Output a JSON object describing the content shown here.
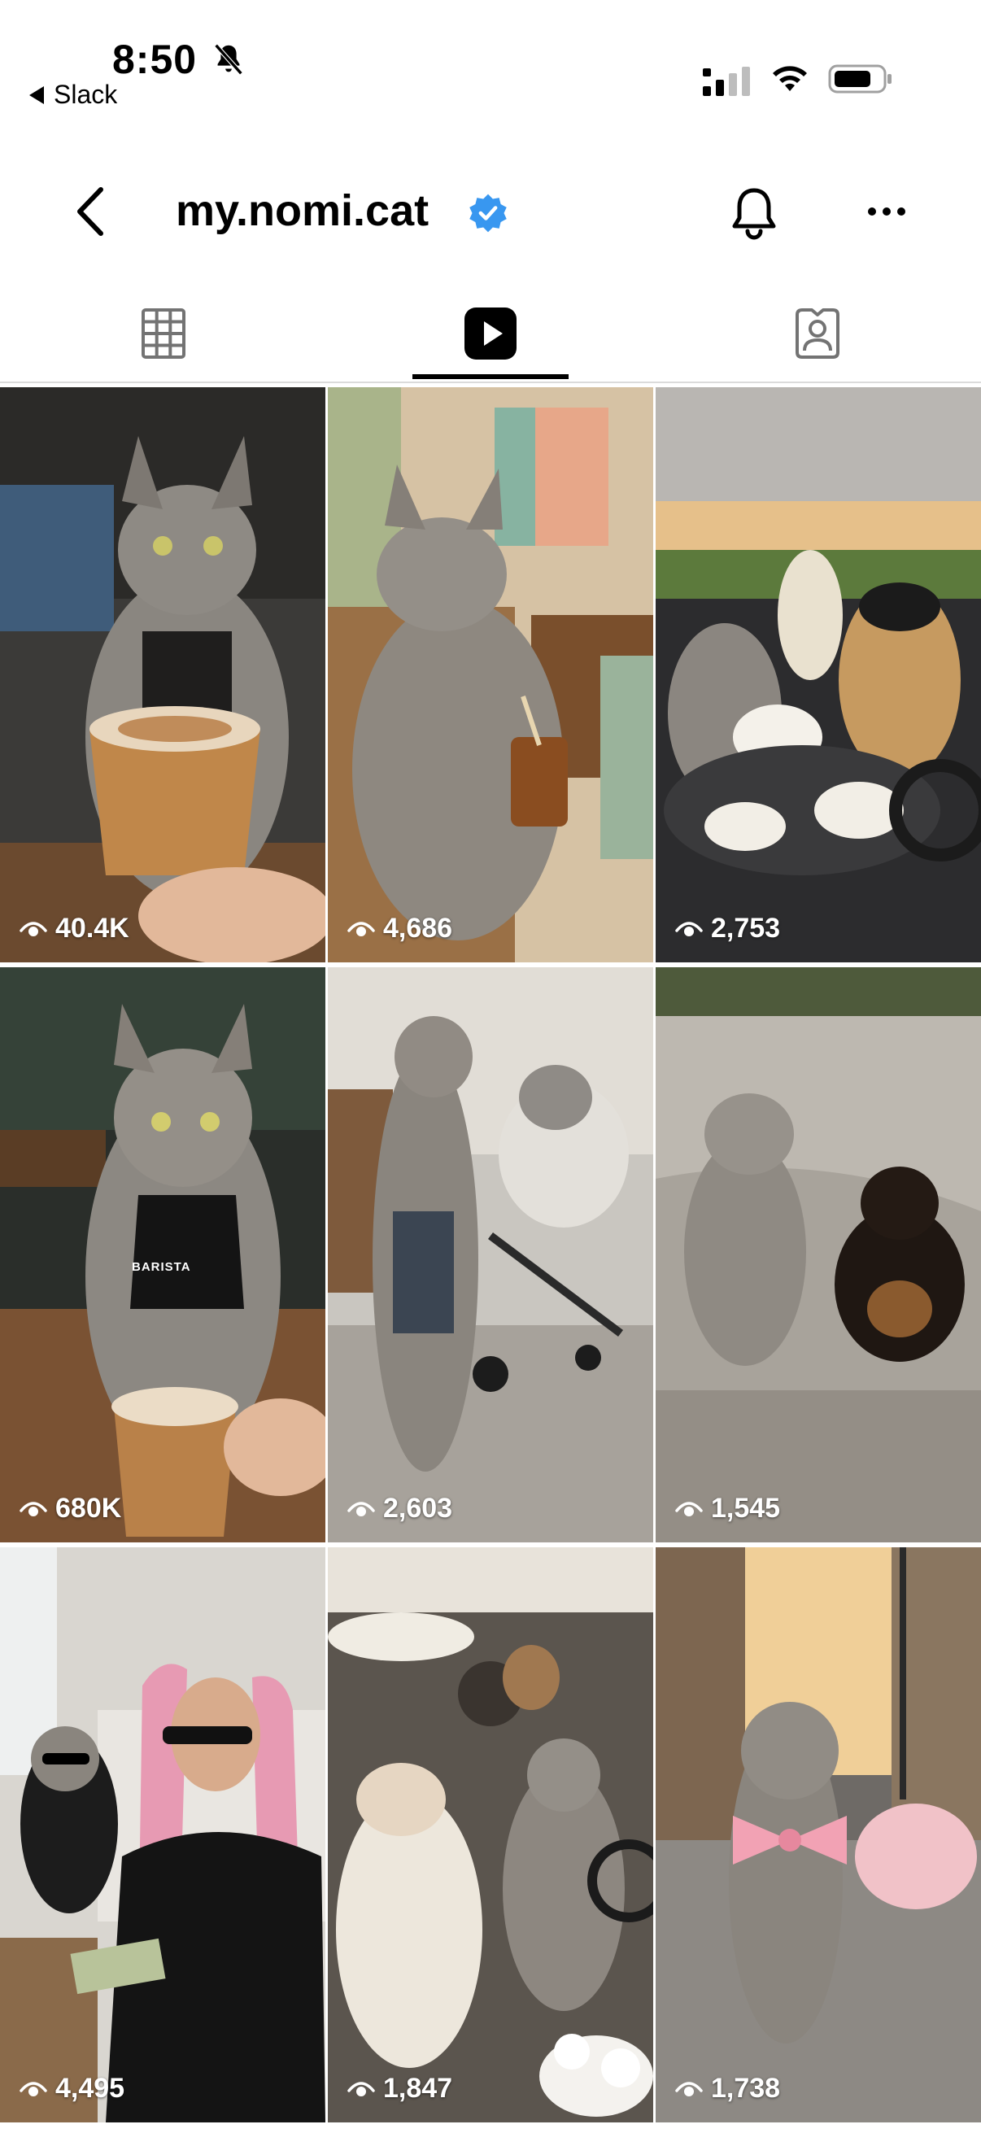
{
  "status_bar": {
    "time": "8:50",
    "back_app": "Slack"
  },
  "header": {
    "username": "my.nomi.cat",
    "verified": true
  },
  "tabs": [
    {
      "icon": "grid-icon",
      "active": false
    },
    {
      "icon": "reels-icon",
      "active": true
    },
    {
      "icon": "tagged-icon",
      "active": false
    }
  ],
  "grid": [
    {
      "views": "40.4K",
      "subject": "cat barista holding latte"
    },
    {
      "views": "4,686",
      "subject": "cat with iced coffee in armchair"
    },
    {
      "views": "2,753",
      "subject": "cats and alpaca in convertible with tea"
    },
    {
      "views": "680K",
      "subject": "cat barista with apron",
      "apron_text": "BARISTA"
    },
    {
      "views": "2,603",
      "subject": "cat with cement mixer"
    },
    {
      "views": "1,545",
      "subject": "cat and dachshund at skatepark"
    },
    {
      "views": "4,495",
      "subject": "cat in sunglasses with pink-haired woman"
    },
    {
      "views": "1,847",
      "subject": "cats in flower-decorated van"
    },
    {
      "views": "1,738",
      "subject": "cat with pink bow on sidewalk"
    }
  ],
  "colors": {
    "verified_blue": "#3897f0",
    "tab_icon_gray": "#737373",
    "divider": "#dbdbdb"
  }
}
